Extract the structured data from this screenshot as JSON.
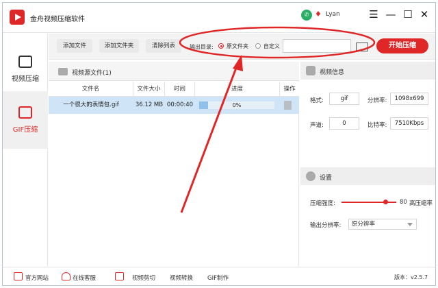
{
  "app": {
    "title": "金舟视频压缩软件",
    "user": "Lyan"
  },
  "window_controls": {
    "menu": "☰",
    "minimize": "—",
    "maximize": "☐",
    "close": "✕"
  },
  "sidebar": {
    "items": [
      {
        "label": "视频压缩",
        "icon": "video-play-icon",
        "active": false
      },
      {
        "label": "GIF压缩",
        "icon": "gif-image-icon",
        "active": true
      }
    ]
  },
  "toolbar": {
    "add_file": "添加文件",
    "add_folder": "添加文件夹",
    "clear_list": "清除列表",
    "output_label": "输出目录:",
    "option_source": "原文件夹",
    "option_custom": "自定义",
    "path_value": "",
    "start": "开始压缩"
  },
  "file_panel": {
    "title": "视频源文件(1)",
    "columns": [
      "文件名",
      "文件大小",
      "时间",
      "进度",
      "操作"
    ],
    "rows": [
      {
        "name": "一个很大的表情包.gif",
        "size": "36.12 MB",
        "time": "00:00:40",
        "progress_text": "0%",
        "progress": 0.12
      }
    ]
  },
  "video_info": {
    "title": "视频信息",
    "format_label": "格式:",
    "format": "gif",
    "resolution_label": "分辨率:",
    "resolution": "1098x699",
    "channel_label": "声道:",
    "channel": "0",
    "bitrate_label": "比特率:",
    "bitrate": "7510Kbps"
  },
  "settings": {
    "title": "设置",
    "strength_label": "压缩强度:",
    "strength_value": "80",
    "strength_suffix": "高压缩率",
    "strength": 80,
    "resolution_label": "输出分辨率:",
    "resolution_value": "原分辨率"
  },
  "bottom_bar": {
    "items": [
      "官方网站",
      "在线客服",
      "视频剪切",
      "视频转换",
      "GIF制作"
    ],
    "version": "版本：v2.5.7"
  },
  "colors": {
    "accent": "#e02727",
    "selected_row": "#cfe4f6"
  }
}
